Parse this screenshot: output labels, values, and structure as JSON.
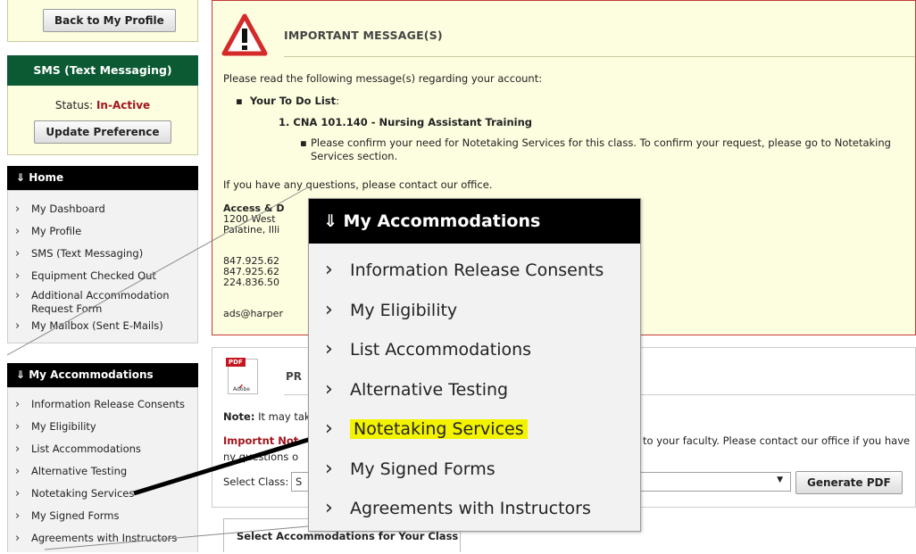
{
  "sidebar": {
    "back_button": "Back to My Profile",
    "sms": {
      "title": "SMS (Text Messaging)",
      "status_label": "Status:",
      "status_value": "In-Active",
      "update_button": "Update Preference"
    },
    "home": {
      "title": "Home",
      "items": [
        "My Dashboard",
        "My Profile",
        "SMS (Text Messaging)",
        "Equipment Checked Out",
        "Additional Accommodation Request Form",
        "My Mailbox (Sent E-Mails)"
      ]
    },
    "accommodations": {
      "title": "My Accommodations",
      "items": [
        "Information Release Consents",
        "My Eligibility",
        "List Accommodations",
        "Alternative Testing",
        "Notetaking Services",
        "My Signed Forms",
        "Agreements with Instructors"
      ]
    }
  },
  "message": {
    "title": "IMPORTANT MESSAGE(S)",
    "intro": "Please read the following message(s) regarding your account:",
    "todo_label": "Your To Do List",
    "todo_colon": ":",
    "course": "1. CNA 101.140 - Nursing Assistant Training",
    "detail": "Please confirm your need for Notetaking Services for this class. To confirm your request, please go to Notetaking Services section.",
    "questions": "If you have any questions, please contact our office.",
    "office_name": "Access & D",
    "address1": "1200 West",
    "address2": "Palatine, Illi",
    "phone1": "847.925.62",
    "phone2": "847.925.62",
    "phone3": "224.836.50",
    "email": "ads@harper"
  },
  "pdf": {
    "title": "PR",
    "icon_text_top": "PDF",
    "icon_text_bottom": "Adobe",
    "note_label": "Note:",
    "note_text": "It may tak",
    "important_label": "Import",
    "important_rest": "nt Not",
    "faculty_text": "to your faculty. Please contact our office if you have",
    "questions_text": "ny questions o",
    "select_label": "Select Class:",
    "select_value": "S",
    "generate_button": "Generate PDF"
  },
  "accom_tab": "Select Accommodations for Your Class",
  "zoom": {
    "title": "My Accommodations",
    "items": [
      "Information Release Consents",
      "My Eligibility",
      "List Accommodations",
      "Alternative Testing",
      "Notetaking Services",
      "My Signed Forms",
      "Agreements with Instructors"
    ],
    "highlighted_index": 4
  },
  "colors": {
    "sms_header": "#0b5a33",
    "status_inactive": "#a0161e",
    "message_border": "#c63838",
    "highlight": "#f3f300",
    "important": "#a0161e"
  }
}
